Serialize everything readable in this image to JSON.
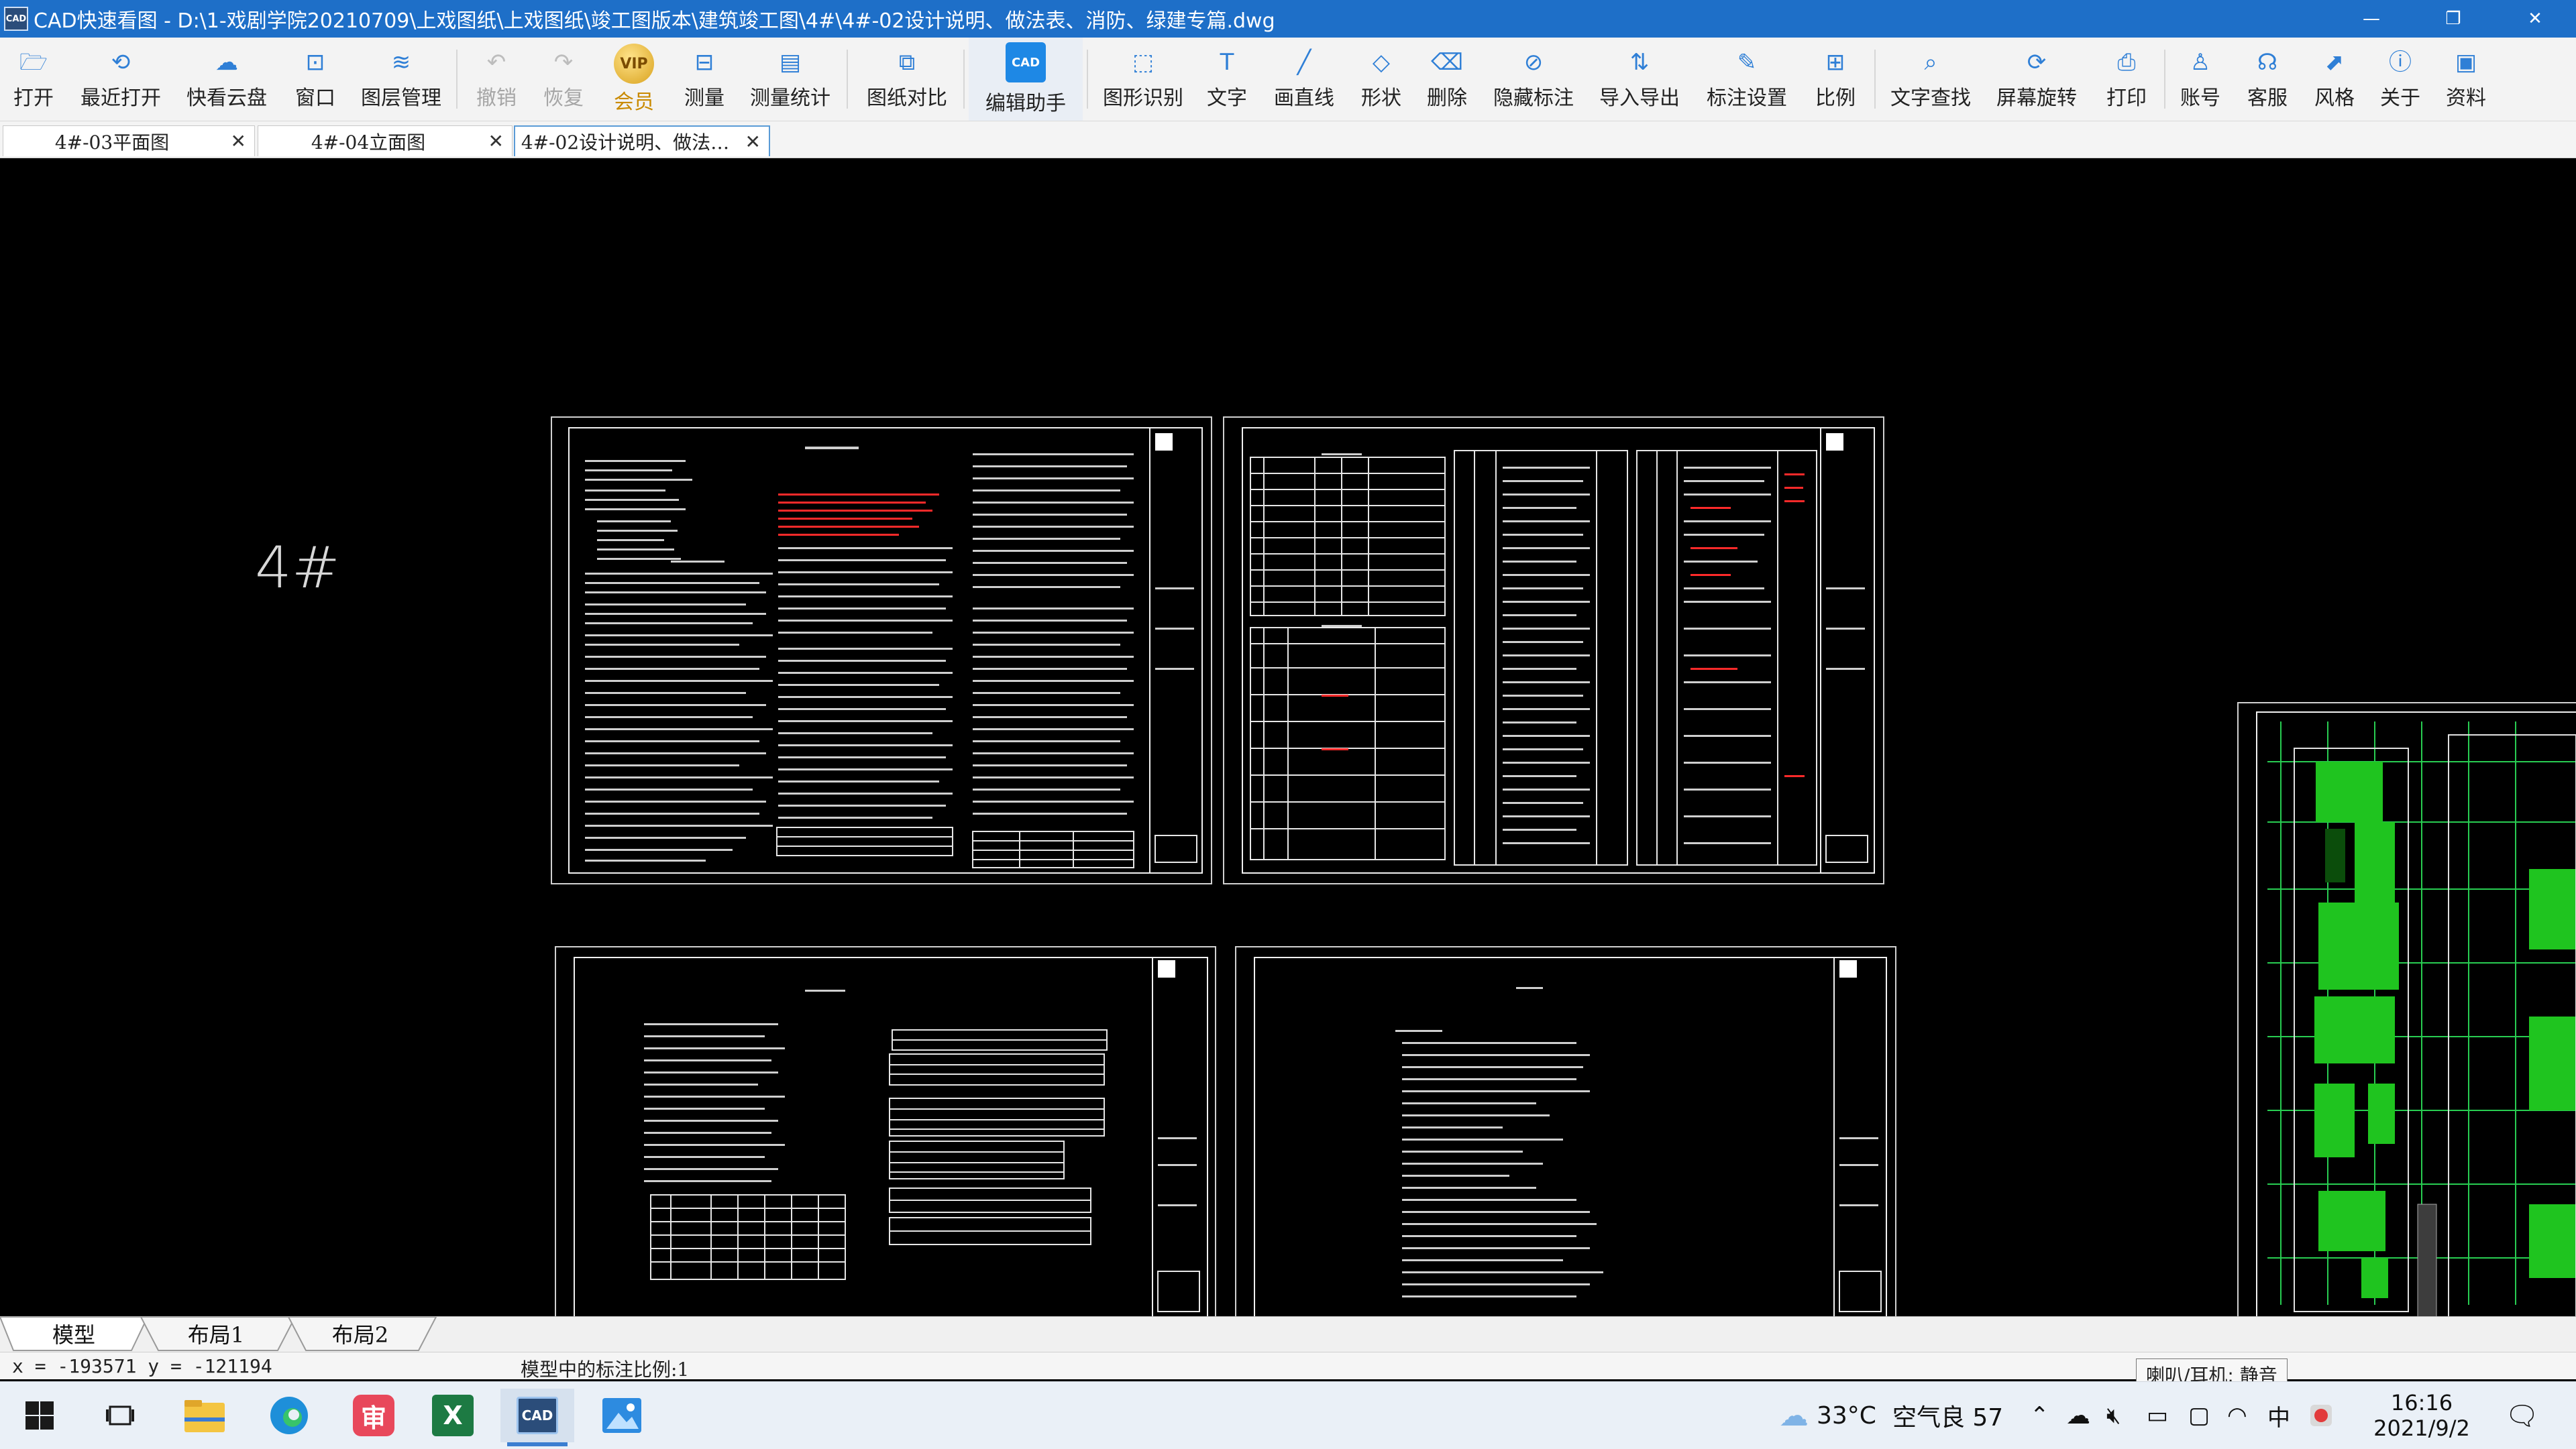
{
  "window": {
    "app_icon_text": "CAD",
    "title": "CAD快速看图 - D:\\1-戏剧学院20210709\\上戏图纸\\上戏图纸\\竣工图版本\\建筑竣工图\\4#\\4#-02设计说明、做法表、消防、绿建专篇.dwg",
    "minimize": "—",
    "maximize": "❐",
    "close": "✕"
  },
  "toolbar": {
    "items": [
      {
        "label": "打开",
        "icon": "folder-icon",
        "glyph": "🗁"
      },
      {
        "label": "最近打开",
        "icon": "clock-icon",
        "glyph": "⟲"
      },
      {
        "label": "快看云盘",
        "icon": "cloud-icon",
        "glyph": "☁"
      },
      {
        "label": "窗口",
        "icon": "window-icon",
        "glyph": "⊡"
      },
      {
        "label": "图层管理",
        "icon": "layers-icon",
        "glyph": "≋"
      },
      {
        "label": "撤销",
        "icon": "undo-icon",
        "glyph": "↶"
      },
      {
        "label": "恢复",
        "icon": "redo-icon",
        "glyph": "↷"
      },
      {
        "label": "会员",
        "icon": "vip-icon",
        "glyph": "VIP"
      },
      {
        "label": "测量",
        "icon": "ruler-icon",
        "glyph": "⊟"
      },
      {
        "label": "测量统计",
        "icon": "stats-icon",
        "glyph": "▤"
      },
      {
        "label": "图纸对比",
        "icon": "compare-icon",
        "glyph": "⧉"
      },
      {
        "label": "编辑助手",
        "icon": "edit-assistant-icon",
        "glyph": "CAD"
      },
      {
        "label": "图形识别",
        "icon": "shape-recognition-icon",
        "glyph": "⬚"
      },
      {
        "label": "文字",
        "icon": "text-icon",
        "glyph": "T"
      },
      {
        "label": "画直线",
        "icon": "line-icon",
        "glyph": "╱"
      },
      {
        "label": "形状",
        "icon": "shapes-icon",
        "glyph": "◇"
      },
      {
        "label": "删除",
        "icon": "eraser-icon",
        "glyph": "⌫"
      },
      {
        "label": "隐藏标注",
        "icon": "eye-off-icon",
        "glyph": "⊘"
      },
      {
        "label": "导入导出",
        "icon": "import-export-icon",
        "glyph": "⇅"
      },
      {
        "label": "标注设置",
        "icon": "annotation-settings-icon",
        "glyph": "✎"
      },
      {
        "label": "比例",
        "icon": "scale-icon",
        "glyph": "⊞"
      },
      {
        "label": "文字查找",
        "icon": "find-text-icon",
        "glyph": "⌕"
      },
      {
        "label": "屏幕旋转",
        "icon": "rotate-icon",
        "glyph": "⟳"
      },
      {
        "label": "打印",
        "icon": "printer-icon",
        "glyph": "⎙"
      },
      {
        "label": "账号",
        "icon": "user-icon",
        "glyph": "♙"
      },
      {
        "label": "客服",
        "icon": "headset-icon",
        "glyph": "☊"
      },
      {
        "label": "风格",
        "icon": "style-icon",
        "glyph": "⬈"
      },
      {
        "label": "关于",
        "icon": "info-icon",
        "glyph": "ⓘ"
      },
      {
        "label": "资料",
        "icon": "docs-icon",
        "glyph": "▣"
      }
    ]
  },
  "tabs": [
    {
      "label": "4#-03平面图",
      "close": "✕",
      "active": false
    },
    {
      "label": "4#-04立面图",
      "close": "✕",
      "active": false
    },
    {
      "label": "4#-02设计说明、做法…",
      "close": "✕",
      "active": true
    }
  ],
  "canvas": {
    "background": "#000000",
    "building_label": "4#",
    "line_color": "#ffffff",
    "accent_red": "#ff2a2a",
    "floorplan_green": "#22d422"
  },
  "layout_tabs": [
    "模型",
    "布局1",
    "布局2"
  ],
  "status": {
    "coords": "x = -193571  y = -121194",
    "annotation_scale": "模型中的标注比例:1"
  },
  "tooltip": "喇叭/耳机: 静音",
  "taskbar": {
    "apps": [
      {
        "name": "windows-start-icon",
        "active": false
      },
      {
        "name": "task-view-icon",
        "active": false
      },
      {
        "name": "file-explorer-icon",
        "active": false
      },
      {
        "name": "edge-browser-icon",
        "active": false
      },
      {
        "name": "review-app-icon",
        "active": false,
        "text": "审"
      },
      {
        "name": "excel-icon",
        "active": false,
        "text": "X"
      },
      {
        "name": "cad-viewer-icon",
        "active": true,
        "text": "CAD"
      },
      {
        "name": "photos-icon",
        "active": false
      }
    ],
    "weather_temp": "33°C",
    "air_quality": "空气良 57",
    "ime_lang": "中",
    "time": "16:16",
    "date": "2021/9/2"
  }
}
